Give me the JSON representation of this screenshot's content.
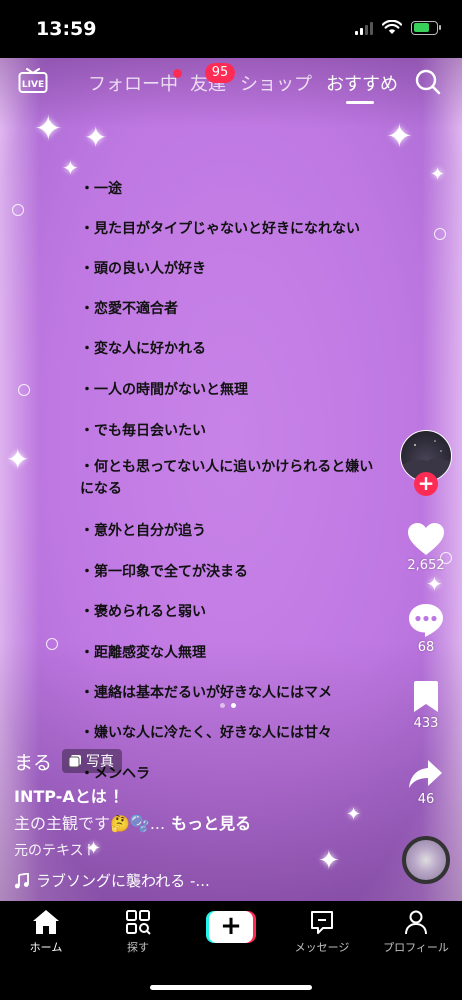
{
  "status_bar": {
    "time": "13:59"
  },
  "top_nav": {
    "live_label": "LIVE",
    "tabs": [
      {
        "label": "フォロー中"
      },
      {
        "label": "友達"
      },
      {
        "label": "ショップ"
      },
      {
        "label": "おすすめ"
      }
    ],
    "friends_badge": "95"
  },
  "post": {
    "list_items": [
      "・一途",
      "・見た目がタイプじゃないと好きになれない",
      "・頭の良い人が好き",
      "・恋愛不適合者",
      "・変な人に好かれる",
      "・一人の時間がないと無理",
      "・でも毎日会いたい",
      "・何とも思ってない人に追いかけられると嫌いになる",
      "・意外と自分が追う",
      "・第一印象で全てが決まる",
      "・褒められると弱い",
      "・距離感変な人無理",
      "・連絡は基本だるいが好きな人にはマメ",
      "・嫌いな人に冷たく、好きな人には甘々",
      "・メンヘラ"
    ],
    "photo_index": 2,
    "photo_count": 2
  },
  "actions": {
    "likes": "2,652",
    "comments": "68",
    "saves": "433",
    "shares": "46"
  },
  "caption": {
    "author": "まる",
    "photo_tag": "写真",
    "title": "INTP-Aとは ！",
    "text": "主の主観です🤔🫧...",
    "more": "もっと見る",
    "original_text": "元のテキスト",
    "sound": "ラブソングに襲われる -..."
  },
  "bottom_nav": {
    "items": [
      {
        "label": "ホーム"
      },
      {
        "label": "探す"
      },
      {
        "label": "メッセージ"
      },
      {
        "label": "プロフィール"
      }
    ],
    "create_label": "+"
  },
  "colors": {
    "accent": "#fe2c55",
    "background": "#c883e8",
    "create_cyan": "#25f4ee",
    "battery_green": "#37d15a"
  }
}
